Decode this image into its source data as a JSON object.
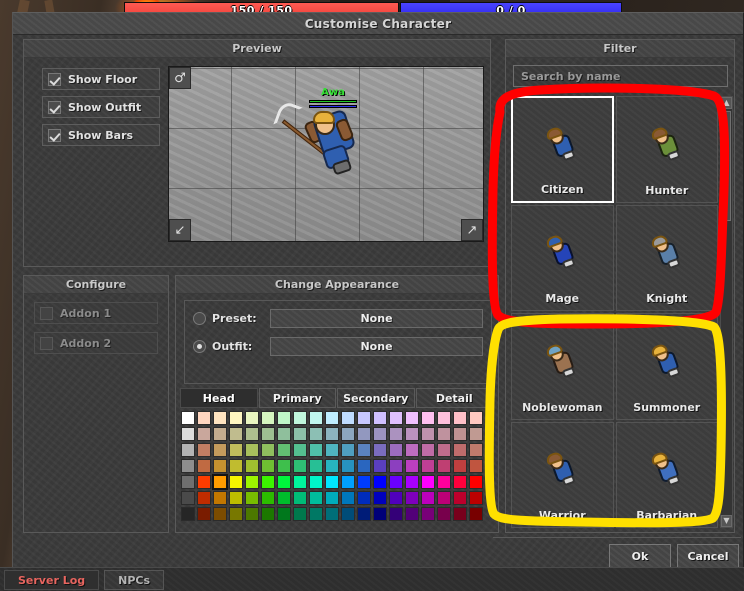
{
  "hud": {
    "health": "150 / 150",
    "mana": "0 / 0",
    "health_color": "#f04038",
    "mana_color": "#2e26ee"
  },
  "window": {
    "title": "Customise Character",
    "ok_label": "Ok",
    "cancel_label": "Cancel"
  },
  "preview": {
    "header": "Preview",
    "checkboxes": [
      {
        "label": "Show Floor",
        "checked": true
      },
      {
        "label": "Show Outfit",
        "checked": true
      },
      {
        "label": "Show Bars",
        "checked": true
      }
    ],
    "character_name": "Awa",
    "name_color": "#35e035",
    "corner_tl_icon": "person-icon",
    "corner_bl_icon": "arrow-down-left-icon",
    "corner_br_icon": "arrow-up-right-icon"
  },
  "configure": {
    "header": "Configure",
    "addons": [
      {
        "label": "Addon 1",
        "checked": false,
        "disabled": true
      },
      {
        "label": "Addon 2",
        "checked": false,
        "disabled": true
      }
    ]
  },
  "appearance": {
    "header": "Change Appearance",
    "rows": [
      {
        "label": "Preset:",
        "value": "None",
        "selected": false
      },
      {
        "label": "Outfit:",
        "value": "None",
        "selected": true
      }
    ],
    "tabs": [
      {
        "label": "Head",
        "active": true
      },
      {
        "label": "Primary",
        "active": false
      },
      {
        "label": "Secondary",
        "active": false
      },
      {
        "label": "Detail",
        "active": false
      }
    ],
    "palette": {
      "columns": 19,
      "rows": 7,
      "selected_index": 78,
      "colors": [
        "#ffffff",
        "#ffd6c0",
        "#ffe4c0",
        "#fff6c0",
        "#eaf6c0",
        "#d6f6c0",
        "#c0f6c8",
        "#c0f6dc",
        "#c0f6ee",
        "#c0eeff",
        "#c0dcff",
        "#c8c8ff",
        "#d0c0ff",
        "#e0c0ff",
        "#f0c0ff",
        "#ffc0f0",
        "#ffc0dc",
        "#ffc0c8",
        "#ffc8c0",
        "#dcdcdc",
        "#c9a79c",
        "#c4ac8e",
        "#c0bc8e",
        "#aebf8e",
        "#9ebf92",
        "#8fbf9c",
        "#8cbfa8",
        "#8cbfb4",
        "#8cb4bf",
        "#8ca6bf",
        "#9298bf",
        "#9c92bf",
        "#ab92bf",
        "#bb92bf",
        "#bf92ad",
        "#bf929e",
        "#bf9292",
        "#c09a92",
        "#b4b4b4",
        "#c17e63",
        "#c49b5c",
        "#c0bc5c",
        "#a8bf5c",
        "#8fbf5e",
        "#62bf72",
        "#54bf90",
        "#4fbfa8",
        "#4fb4bf",
        "#4f9ebf",
        "#5a82bf",
        "#7a6cbf",
        "#9c6cbf",
        "#bd6cbf",
        "#bf6ca6",
        "#bf6c8c",
        "#bf6c6c",
        "#c07a6c",
        "#8e8e8e",
        "#c06a42",
        "#c4912f",
        "#c0bc2f",
        "#a0bf2f",
        "#6fbf32",
        "#3ebf4c",
        "#2ebf74",
        "#27bf95",
        "#27b4bf",
        "#2792bf",
        "#2a66bf",
        "#5a3fbf",
        "#8c3fbf",
        "#bb3fbf",
        "#bf3f95",
        "#bf3f72",
        "#bf3f3f",
        "#c0553f",
        "#6f6f6f",
        "#ff3c00",
        "#ff9c00",
        "#f5f500",
        "#9cf500",
        "#3cf500",
        "#00f53c",
        "#00f59c",
        "#00f5c8",
        "#00e6ff",
        "#00a0ff",
        "#003cff",
        "#0000ff",
        "#6a00ff",
        "#a800ff",
        "#ff00ff",
        "#ff009c",
        "#ff003c",
        "#ff0000",
        "#4a4a4a",
        "#c02c00",
        "#c27700",
        "#bcbc00",
        "#78bc00",
        "#2cbc00",
        "#00bc2c",
        "#00bc77",
        "#00bc9c",
        "#00acbc",
        "#0078bc",
        "#002cbc",
        "#0000bc",
        "#5000bc",
        "#7e00bc",
        "#bc00bc",
        "#bc0077",
        "#bc002c",
        "#bc0000",
        "#262626",
        "#7a1c00",
        "#7c4c00",
        "#787800",
        "#4c7800",
        "#1c7800",
        "#00781c",
        "#00784c",
        "#007864",
        "#006e78",
        "#004c78",
        "#001c78",
        "#000078",
        "#340078",
        "#520078",
        "#780078",
        "#78004c",
        "#78001c",
        "#780000"
      ]
    }
  },
  "filter": {
    "header": "Filter",
    "search_placeholder": "Search by name",
    "outfits": [
      {
        "name": "Citizen",
        "selected": true,
        "body": "#2f5fb0",
        "accent": "#8a5a34"
      },
      {
        "name": "Hunter",
        "selected": false,
        "body": "#6b8f3a",
        "accent": "#8a5a34"
      },
      {
        "name": "Mage",
        "selected": false,
        "body": "#2544b8",
        "accent": "#2f5fb0"
      },
      {
        "name": "Knight",
        "selected": false,
        "body": "#5a7fa8",
        "accent": "#9a9a9a"
      },
      {
        "name": "Noblewoman",
        "selected": false,
        "body": "#9b7250",
        "accent": "#6fa3c4"
      },
      {
        "name": "Summoner",
        "selected": false,
        "body": "#2f5fb0",
        "accent": "#e8b23c"
      },
      {
        "name": "Warrior",
        "selected": false,
        "body": "#2f5fb0",
        "accent": "#8a5a34"
      },
      {
        "name": "Barbarian",
        "selected": false,
        "body": "#3f6fbf",
        "accent": "#e8b23c"
      }
    ],
    "scroll_up_icon": "triangle-up-icon",
    "scroll_down_icon": "triangle-down-icon"
  },
  "statusbar": {
    "tabs": [
      {
        "label": "Server Log",
        "active": true,
        "color": "#e8655f"
      },
      {
        "label": "NPCs",
        "active": false,
        "color": "#b5b5b5"
      }
    ]
  },
  "annotations": [
    {
      "shape": "circle",
      "color": "#ff0000",
      "target": "outfits-top-group"
    },
    {
      "shape": "circle",
      "color": "#ffe000",
      "target": "outfits-bottom-group"
    }
  ]
}
